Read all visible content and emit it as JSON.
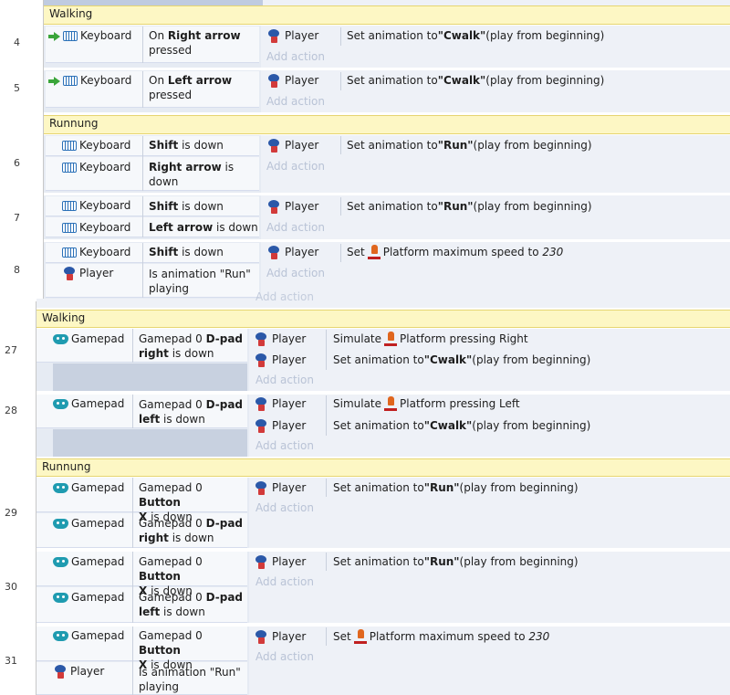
{
  "groups": {
    "walking1": "Walking",
    "running1": "Runnung",
    "walking2": "Walking",
    "running2": "Runnung"
  },
  "line_numbers": [
    "4",
    "5",
    "6",
    "7",
    "8",
    "27",
    "28",
    "29",
    "30",
    "31"
  ],
  "add_action": "Add action",
  "objects": {
    "keyboard": "Keyboard",
    "player": "Player",
    "gamepad": "Gamepad"
  },
  "events": {
    "e4": {
      "cond_pre": "On ",
      "cond_bold": "Right arrow",
      "cond_post": "pressed"
    },
    "e5": {
      "cond_pre": "On ",
      "cond_bold": "Left arrow",
      "cond_post": "pressed"
    },
    "e6": {
      "c1_bold": "Shift",
      "c1_post": " is down",
      "c2_bold": "Right arrow",
      "c2_post": " is",
      "c2_post2": "down"
    },
    "e7": {
      "c1_bold": "Shift",
      "c1_post": " is down",
      "c2_bold": "Left arrow",
      "c2_post": " is down"
    },
    "e8": {
      "c1_bold": "Shift",
      "c1_post": " is down",
      "c2_line1": "Is animation \"Run\"",
      "c2_line2": "playing"
    },
    "e27": {
      "c_pre": "Gamepad 0 ",
      "c_bold": "D-pad",
      "c_bold2": "right",
      "c_post": " is down"
    },
    "e28": {
      "c_pre": "Gamepad 0 ",
      "c_bold": "D-pad",
      "c_bold2": "left",
      "c_post": " is down"
    },
    "e29": {
      "c1_pre": "Gamepad 0 ",
      "c1_bold": "Button",
      "c1_bold2": "X",
      "c1_post": " is down",
      "c2_pre": "Gamepad 0 ",
      "c2_bold": "D-pad",
      "c2_bold2": "right",
      "c2_post": " is down"
    },
    "e30": {
      "c1_pre": "Gamepad 0 ",
      "c1_bold": "Button",
      "c1_bold2": "X",
      "c1_post": " is down",
      "c2_pre": "Gamepad 0 ",
      "c2_bold": "D-pad",
      "c2_bold2": "left",
      "c2_post": " is down"
    },
    "e31": {
      "c1_pre": "Gamepad 0 ",
      "c1_bold": "Button",
      "c1_bold2": "X",
      "c1_post": " is down",
      "c2_line1": "Is animation \"Run\"",
      "c2_line2": "playing"
    }
  },
  "actions": {
    "set_anim_pre": "Set animation to ",
    "cwalk": "\"Cwalk\"",
    "run": "\"Run\"",
    "play_post": " (play from beginning)",
    "set_pre": "Set ",
    "max_speed": " Platform maximum speed to ",
    "speed_value": "230",
    "simulate": "Simulate ",
    "press_right": " Platform pressing Right",
    "press_left": " Platform pressing Left"
  }
}
